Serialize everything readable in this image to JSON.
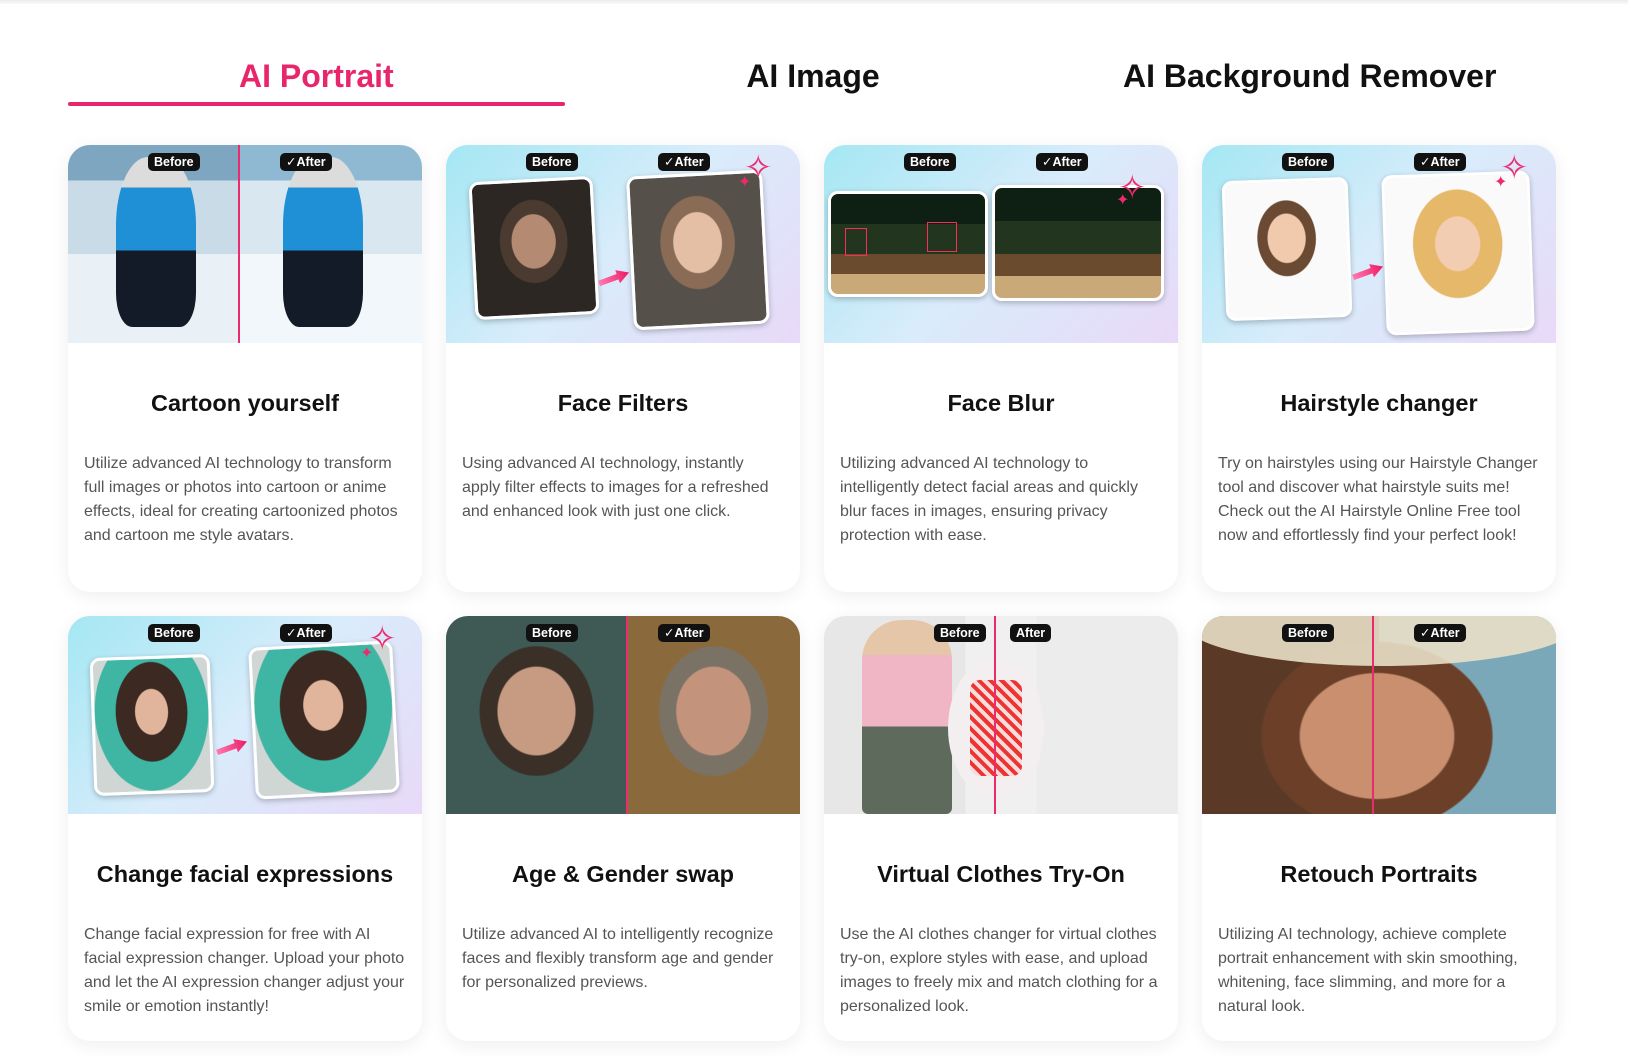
{
  "tabs": [
    {
      "label": "AI Portrait",
      "active": true
    },
    {
      "label": "AI Image",
      "active": false
    },
    {
      "label": "AI Background Remover",
      "active": false
    }
  ],
  "badges": {
    "before": "Before",
    "after": "✓After",
    "after_plain": "After"
  },
  "colors": {
    "accent": "#e8266b"
  },
  "cards": [
    {
      "title": "Cartoon yourself",
      "desc": "Utilize advanced AI technology to transform full images or photos into cartoon or anime effects, ideal for creating cartoonized photos and cartoon me style avatars."
    },
    {
      "title": "Face Filters",
      "desc": "Using advanced AI technology, instantly apply filter effects to images for a refreshed and enhanced look with just one click."
    },
    {
      "title": "Face Blur",
      "desc": "Utilizing advanced AI technology to intelligently detect facial areas and quickly blur faces in images, ensuring privacy protection with ease."
    },
    {
      "title": "Hairstyle changer",
      "desc": "Try on hairstyles using our Hairstyle Changer tool and discover what hairstyle suits me! Check out the AI Hairstyle Online Free tool now and effortlessly find your perfect look!"
    },
    {
      "title": "Change facial expressions",
      "desc": "Change facial expression for free with AI facial expression changer. Upload your photo and let the AI expression changer adjust your smile or emotion instantly!"
    },
    {
      "title": "Age & Gender swap",
      "desc": "Utilize advanced AI to intelligently recognize faces and flexibly transform age and gender for personalized previews."
    },
    {
      "title": "Virtual Clothes Try-On",
      "desc": "Use the AI clothes changer for virtual clothes try-on, explore styles with ease, and upload images to freely mix and match clothing for a personalized look."
    },
    {
      "title": "Retouch Portraits",
      "desc": "Utilizing AI technology, achieve complete portrait enhancement with skin smoothing, whitening, face slimming, and more for a natural look."
    }
  ]
}
